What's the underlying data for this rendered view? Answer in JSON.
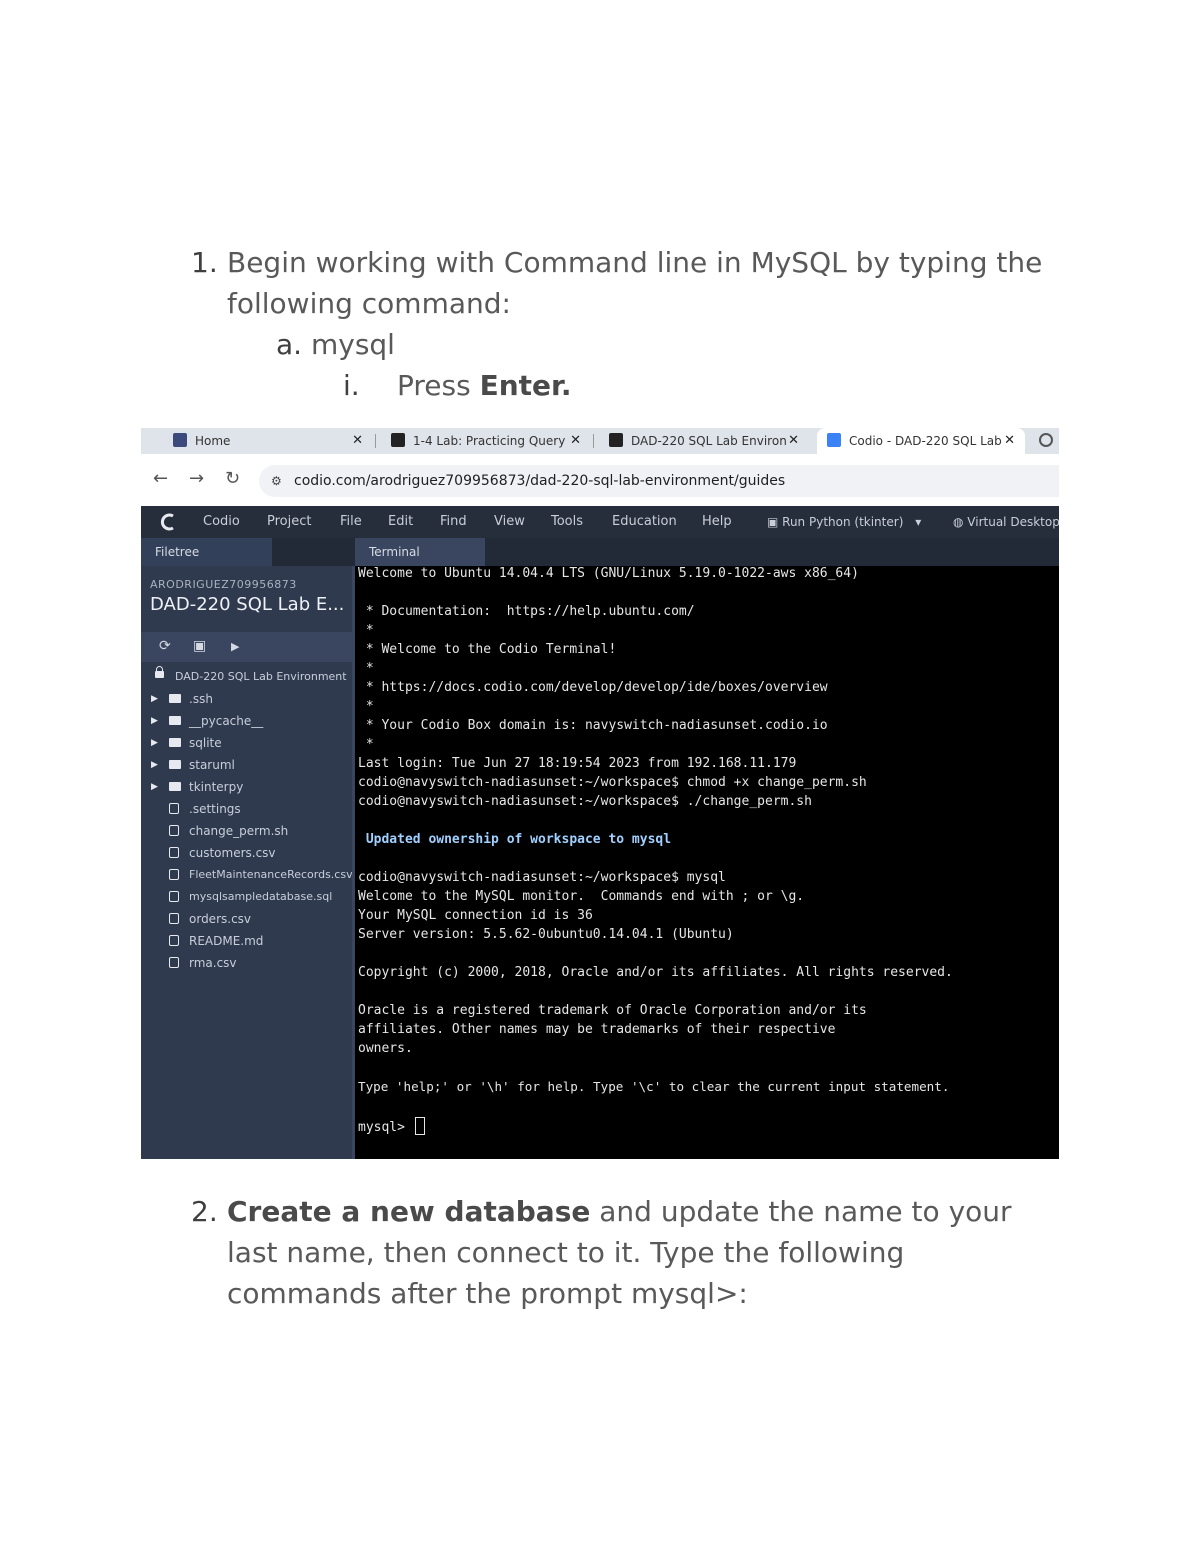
{
  "steps": {
    "step1": {
      "number": "1.",
      "line1": "Begin working with Command line in MySQL by typing the",
      "line2": "following command:",
      "sub_a_marker": "a.",
      "sub_a_text": "mysql",
      "sub_i_marker": "i.",
      "sub_i_text": "Press ",
      "sub_i_bold": "Enter."
    },
    "step2": {
      "number": "2.",
      "bold": "Create a new database",
      "line1_rest": " and update the name to your",
      "line2": "last name, then connect to it. Type the following",
      "line3": "commands after the prompt mysql>:"
    }
  },
  "browser": {
    "tabs": [
      {
        "label": "Home",
        "close": "✕"
      },
      {
        "label": "1-4 Lab: Practicing Query",
        "close": "✕"
      },
      {
        "label": "DAD-220 SQL Lab Environ",
        "close": "✕"
      },
      {
        "label": "Codio - DAD-220 SQL Lab",
        "close": "✕"
      }
    ],
    "url": "codio.com/arodriguez709956873/dad-220-sql-lab-environment/guides"
  },
  "ide": {
    "menu": [
      "Codio",
      "Project",
      "File",
      "Edit",
      "Find",
      "View",
      "Tools",
      "Education",
      "Help"
    ],
    "run_button": "Run Python (tkinter)",
    "virtual_desktop": "Virtual Desktop",
    "filetree_tab": "Filetree",
    "terminal_tab": "Terminal",
    "project_user": "ARODRIGUEZ709956873",
    "project_name": "DAD-220 SQL Lab E...",
    "root_folder": "DAD-220 SQL Lab Environment",
    "folders": [
      ".ssh",
      "__pycache__",
      "sqlite",
      "staruml",
      "tkinterpy"
    ],
    "files": [
      ".settings",
      "change_perm.sh",
      "customers.csv",
      "FleetMaintenanceRecords.csv",
      "mysqlsampledatabase.sql",
      "orders.csv",
      "README.md",
      "rma.csv"
    ]
  },
  "terminal_lines": [
    "Welcome to Ubuntu 14.04.4 LTS (GNU/Linux 5.19.0-1022-aws x86_64)",
    "",
    " * Documentation:  https://help.ubuntu.com/",
    " *",
    " * Welcome to the Codio Terminal!",
    " *",
    " * https://docs.codio.com/develop/develop/ide/boxes/overview",
    " *",
    " * Your Codio Box domain is: navyswitch-nadiasunset.codio.io",
    " *",
    "Last login: Tue Jun 27 18:19:54 2023 from 192.168.11.179",
    "codio@navyswitch-nadiasunset:~/workspace$ chmod +x change_perm.sh",
    "codio@navyswitch-nadiasunset:~/workspace$ ./change_perm.sh",
    "",
    " Updated ownership of workspace to mysql",
    "",
    "codio@navyswitch-nadiasunset:~/workspace$ mysql",
    "Welcome to the MySQL monitor.  Commands end with ; or \\g.",
    "Your MySQL connection id is 36",
    "Server version: 5.5.62-0ubuntu0.14.04.1 (Ubuntu)",
    "",
    "Copyright (c) 2000, 2018, Oracle and/or its affiliates. All rights reserved.",
    "",
    "Oracle is a registered trademark of Oracle Corporation and/or its",
    "affiliates. Other names may be trademarks of their respective",
    "owners.",
    "",
    "Type 'help;' or '\\h' for help. Type '\\c' to clear the current input statement.",
    "",
    "mysql> "
  ],
  "colors": {
    "accent": "#1a73e8",
    "terminal_bg": "#000000",
    "sidebar_bg": "#2f3a4f"
  }
}
